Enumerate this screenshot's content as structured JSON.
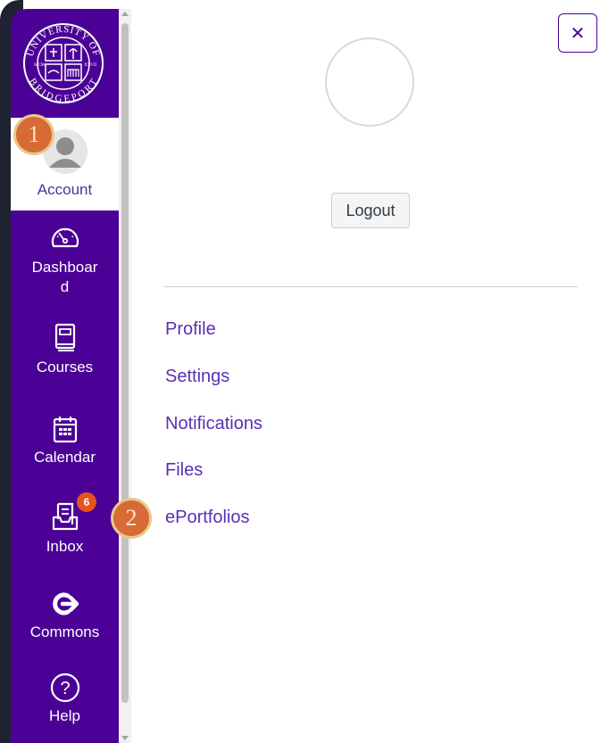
{
  "logo": {
    "top_text": "UNIVERSITY OF",
    "bottom_text": "BRIDGEPORT",
    "year_left": "MCM",
    "year_right": "XXVII"
  },
  "sidebar": {
    "items": [
      {
        "id": "account",
        "label": "Account",
        "icon": "user-avatar-icon",
        "active": true
      },
      {
        "id": "dashboard",
        "label_line1": "Dashboar",
        "label_line2": "d",
        "icon": "speedometer-icon"
      },
      {
        "id": "courses",
        "label": "Courses",
        "icon": "book-icon"
      },
      {
        "id": "calendar",
        "label": "Calendar",
        "icon": "calendar-icon"
      },
      {
        "id": "inbox",
        "label": "Inbox",
        "icon": "inbox-icon",
        "badge": "6"
      },
      {
        "id": "commons",
        "label": "Commons",
        "icon": "commons-arrow-icon"
      },
      {
        "id": "help",
        "label": "Help",
        "icon": "help-icon",
        "glyph": "?"
      }
    ]
  },
  "tray": {
    "close_glyph": "✕",
    "logout_label": "Logout",
    "links": [
      "Profile",
      "Settings",
      "Notifications",
      "Files",
      "ePortfolios"
    ]
  },
  "callouts": [
    "1",
    "2"
  ],
  "colors": {
    "brand": "#4b0196",
    "link": "#5a2fb5",
    "badge": "#e5541f",
    "callout": "#d86a35"
  }
}
